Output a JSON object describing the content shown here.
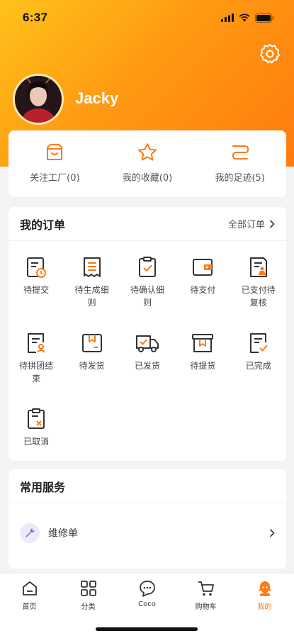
{
  "status_bar": {
    "time": "6:37"
  },
  "profile": {
    "username": "Jacky"
  },
  "quick_links": [
    {
      "label": "关注工厂(0)",
      "icon": "factory-icon"
    },
    {
      "label": "我的收藏(0)",
      "icon": "star-icon"
    },
    {
      "label": "我的足迹(5)",
      "icon": "footprint-icon"
    }
  ],
  "orders": {
    "title": "我的订单",
    "see_all": "全部订单",
    "items": [
      {
        "label": "待提交",
        "icon": "pending-submit-icon"
      },
      {
        "label": "待生成细则",
        "icon": "pending-generate-icon"
      },
      {
        "label": "待确认细则",
        "icon": "pending-confirm-icon"
      },
      {
        "label": "待支付",
        "icon": "wallet-icon"
      },
      {
        "label": "已支付待复核",
        "icon": "paid-review-icon"
      },
      {
        "label": "待拼团结束",
        "icon": "group-buy-icon"
      },
      {
        "label": "待发货",
        "icon": "box-icon"
      },
      {
        "label": "已发货",
        "icon": "truck-icon"
      },
      {
        "label": "待提货",
        "icon": "pickup-icon"
      },
      {
        "label": "已完成",
        "icon": "completed-icon"
      },
      {
        "label": "已取消",
        "icon": "cancelled-icon"
      }
    ]
  },
  "services": {
    "title": "常用服务",
    "items": [
      {
        "label": "维修单",
        "icon": "wrench-icon"
      }
    ]
  },
  "tabbar": {
    "items": [
      {
        "label": "首页",
        "icon": "home-icon"
      },
      {
        "label": "分类",
        "icon": "grid-icon"
      },
      {
        "label": "Coco",
        "icon": "chat-icon"
      },
      {
        "label": "购物车",
        "icon": "cart-icon"
      },
      {
        "label": "我的",
        "icon": "profile-icon"
      }
    ],
    "active": "我的"
  },
  "colors": {
    "accent": "#ff7a10",
    "header_start": "#ffc21a",
    "header_end": "#ff7a10"
  }
}
